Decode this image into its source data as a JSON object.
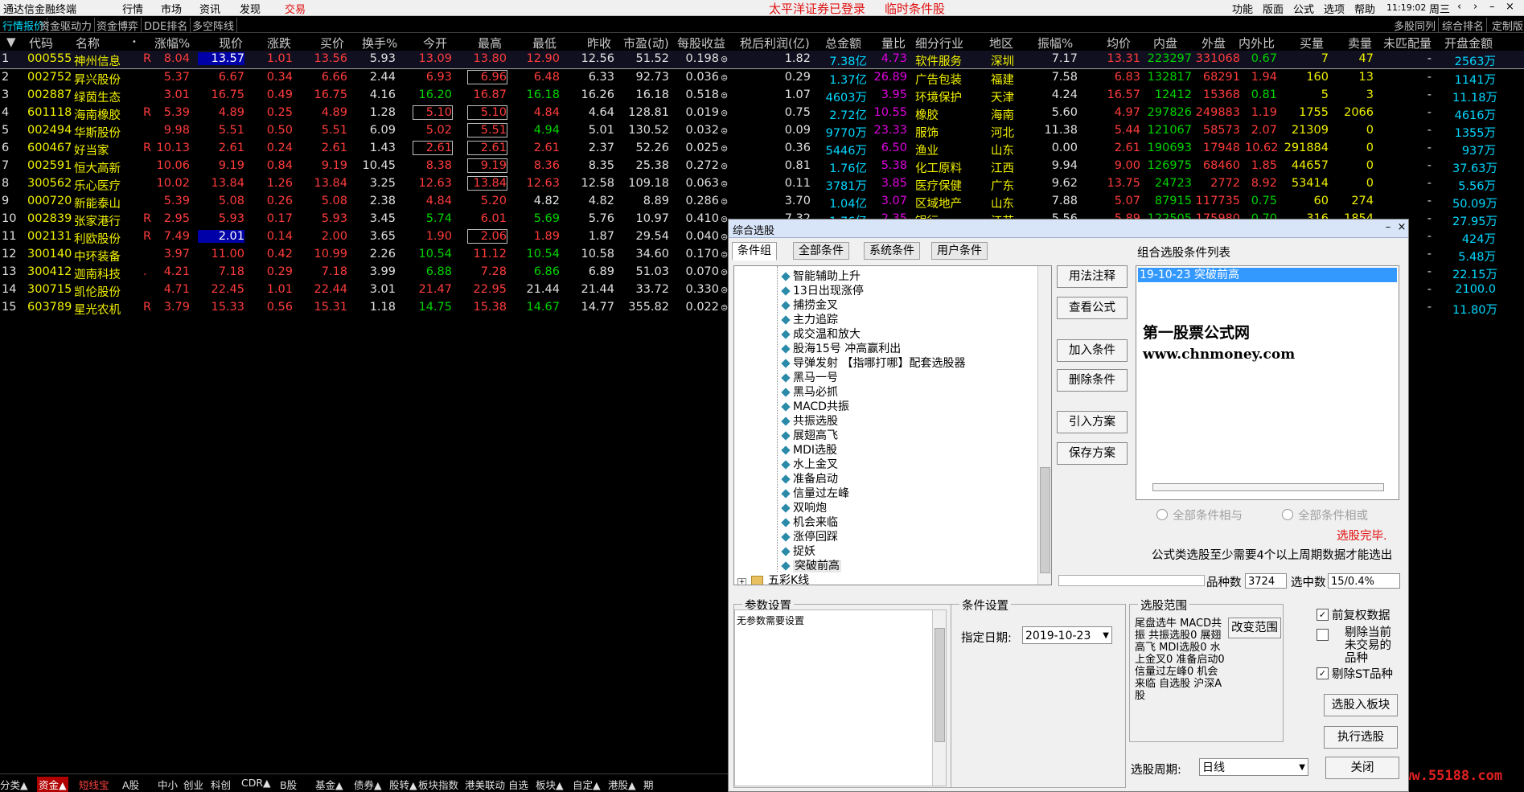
{
  "menu": {
    "app_title": "通达信金融终端",
    "items": [
      "行情",
      "市场",
      "资讯",
      "发现",
      "交易"
    ],
    "banner_login": "太平洋证券已登录",
    "banner_stock": "临时条件股",
    "right_items": [
      "功能",
      "版面",
      "公式",
      "选项",
      "帮助"
    ],
    "time": "11:19:02",
    "weekday": "周三"
  },
  "tabs": {
    "left": [
      "行情报价",
      "资金驱动力",
      "资金博弈",
      "DDE排名",
      "多空阵线"
    ],
    "right": [
      "多股同列",
      "综合排名",
      "定制版"
    ]
  },
  "table": {
    "headers": [
      "代码",
      "名称",
      "涨幅%",
      "现价",
      "涨跌",
      "买价",
      "换手%",
      "今开",
      "最高",
      "最低",
      "昨收",
      "市盈(动)",
      "每股收益",
      "税后利润(亿)",
      "总金额",
      "量比",
      "细分行业",
      "地区",
      "振幅%",
      "均价",
      "内盘",
      "外盘",
      "内外比",
      "买量",
      "卖量",
      "未匹配量",
      "开盘金额"
    ],
    "rows": [
      {
        "n": "1",
        "code": "000555",
        "name": "神州信息",
        "r": "R",
        "zf": "8.04",
        "xj": "13.57",
        "zd": "1.01",
        "mj": "13.56",
        "hs": "5.93",
        "jk": "13.09",
        "zg": "13.80",
        "zdi": "12.90",
        "zs": "12.56",
        "syl": "51.52",
        "mgsy": "0.198",
        "lr": "1.82",
        "zje": "7.38亿",
        "lb": "4.73",
        "hy": "软件服务",
        "dq": "深圳",
        "zf2": "7.17",
        "jj": "13.31",
        "np": "223297",
        "wp": "331068",
        "nwb": "0.67",
        "ml": "7",
        "sl": "47",
        "wpp": "-",
        "kpje": "2563万"
      },
      {
        "n": "2",
        "code": "002752",
        "name": "昇兴股份",
        "r": "",
        "zf": "5.37",
        "xj": "6.67",
        "zd": "0.34",
        "mj": "6.66",
        "hs": "2.44",
        "jk": "6.93",
        "zg": "6.96",
        "zdi": "6.48",
        "zs": "6.33",
        "syl": "92.73",
        "mgsy": "0.036",
        "lr": "0.29",
        "zje": "1.37亿",
        "lb": "26.89",
        "hy": "广告包装",
        "dq": "福建",
        "zf2": "7.58",
        "jj": "6.83",
        "np": "132817",
        "wp": "68291",
        "nwb": "1.94",
        "ml": "160",
        "sl": "13",
        "wpp": "-",
        "kpje": "1141万"
      },
      {
        "n": "3",
        "code": "002887",
        "name": "绿茵生态",
        "r": "",
        "zf": "3.01",
        "xj": "16.75",
        "zd": "0.49",
        "mj": "16.75",
        "hs": "4.16",
        "jk": "16.20",
        "zg": "16.87",
        "zdi": "16.18",
        "zs": "16.26",
        "syl": "16.18",
        "mgsy": "0.518",
        "lr": "1.07",
        "zje": "4603万",
        "lb": "3.95",
        "hy": "环境保护",
        "dq": "天津",
        "zf2": "4.24",
        "jj": "16.57",
        "np": "12412",
        "wp": "15368",
        "nwb": "0.81",
        "ml": "5",
        "sl": "3",
        "wpp": "-",
        "kpje": "11.18万"
      },
      {
        "n": "4",
        "code": "601118",
        "name": "海南橡胶",
        "r": "R",
        "zf": "5.39",
        "xj": "4.89",
        "zd": "0.25",
        "mj": "4.89",
        "hs": "1.28",
        "jk": "5.10",
        "zg": "5.10",
        "zdi": "4.84",
        "zs": "4.64",
        "syl": "128.81",
        "mgsy": "0.019",
        "lr": "0.75",
        "zje": "2.72亿",
        "lb": "10.55",
        "hy": "橡胶",
        "dq": "海南",
        "zf2": "5.60",
        "jj": "4.97",
        "np": "297826",
        "wp": "249883",
        "nwb": "1.19",
        "ml": "1755",
        "sl": "2066",
        "wpp": "-",
        "kpje": "4616万"
      },
      {
        "n": "5",
        "code": "002494",
        "name": "华斯股份",
        "r": "",
        "zf": "9.98",
        "xj": "5.51",
        "zd": "0.50",
        "mj": "5.51",
        "hs": "6.09",
        "jk": "5.02",
        "zg": "5.51",
        "zdi": "4.94",
        "zs": "5.01",
        "syl": "130.52",
        "mgsy": "0.032",
        "lr": "0.09",
        "zje": "9770万",
        "lb": "23.33",
        "hy": "服饰",
        "dq": "河北",
        "zf2": "11.38",
        "jj": "5.44",
        "np": "121067",
        "wp": "58573",
        "nwb": "2.07",
        "ml": "21309",
        "sl": "0",
        "wpp": "-",
        "kpje": "1355万"
      },
      {
        "n": "6",
        "code": "600467",
        "name": "好当家",
        "r": "R",
        "zf": "10.13",
        "xj": "2.61",
        "zd": "0.24",
        "mj": "2.61",
        "hs": "1.43",
        "jk": "2.61",
        "zg": "2.61",
        "zdi": "2.61",
        "zs": "2.37",
        "syl": "52.26",
        "mgsy": "0.025",
        "lr": "0.36",
        "zje": "5446万",
        "lb": "6.50",
        "hy": "渔业",
        "dq": "山东",
        "zf2": "0.00",
        "jj": "2.61",
        "np": "190693",
        "wp": "17948",
        "nwb": "10.62",
        "ml": "291884",
        "sl": "0",
        "wpp": "-",
        "kpje": "937万"
      },
      {
        "n": "7",
        "code": "002591",
        "name": "恒大高新",
        "r": "",
        "zf": "10.06",
        "xj": "9.19",
        "zd": "0.84",
        "mj": "9.19",
        "hs": "10.45",
        "jk": "8.38",
        "zg": "9.19",
        "zdi": "8.36",
        "zs": "8.35",
        "syl": "25.38",
        "mgsy": "0.272",
        "lr": "0.81",
        "zje": "1.76亿",
        "lb": "5.38",
        "hy": "化工原料",
        "dq": "江西",
        "zf2": "9.94",
        "jj": "9.00",
        "np": "126975",
        "wp": "68460",
        "nwb": "1.85",
        "ml": "44657",
        "sl": "0",
        "wpp": "-",
        "kpje": "37.63万"
      },
      {
        "n": "8",
        "code": "300562",
        "name": "乐心医疗",
        "r": "",
        "zf": "10.02",
        "xj": "13.84",
        "zd": "1.26",
        "mj": "13.84",
        "hs": "3.25",
        "jk": "12.63",
        "zg": "13.84",
        "zdi": "12.63",
        "zs": "12.58",
        "syl": "109.18",
        "mgsy": "0.063",
        "lr": "0.11",
        "zje": "3781万",
        "lb": "3.85",
        "hy": "医疗保健",
        "dq": "广东",
        "zf2": "9.62",
        "jj": "13.75",
        "np": "24723",
        "wp": "2772",
        "nwb": "8.92",
        "ml": "53414",
        "sl": "0",
        "wpp": "-",
        "kpje": "5.56万"
      },
      {
        "n": "9",
        "code": "000720",
        "name": "新能泰山",
        "r": "",
        "zf": "5.39",
        "xj": "5.08",
        "zd": "0.26",
        "mj": "5.08",
        "hs": "2.38",
        "jk": "4.84",
        "zg": "5.20",
        "zdi": "4.82",
        "zs": "4.82",
        "syl": "8.89",
        "mgsy": "0.286",
        "lr": "3.70",
        "zje": "1.04亿",
        "lb": "3.07",
        "hy": "区域地产",
        "dq": "山东",
        "zf2": "7.88",
        "jj": "5.07",
        "np": "87915",
        "wp": "117735",
        "nwb": "0.75",
        "ml": "60",
        "sl": "274",
        "wpp": "-",
        "kpje": "50.09万"
      },
      {
        "n": "10",
        "code": "002839",
        "name": "张家港行",
        "r": "R",
        "zf": "2.95",
        "xj": "5.93",
        "zd": "0.17",
        "mj": "5.93",
        "hs": "3.45",
        "jk": "5.74",
        "zg": "6.01",
        "zdi": "5.69",
        "zs": "5.76",
        "syl": "10.97",
        "mgsy": "0.410",
        "lr": "7.32",
        "zje": "1.76亿",
        "lb": "2.35",
        "hy": "银行",
        "dq": "江苏",
        "zf2": "5.56",
        "jj": "5.89",
        "np": "122505",
        "wp": "175980",
        "nwb": "0.70",
        "ml": "316",
        "sl": "1854",
        "wpp": "-",
        "kpje": "27.95万"
      },
      {
        "n": "11",
        "code": "002131",
        "name": "利欧股份",
        "r": "R",
        "zf": "7.49",
        "xj": "2.01",
        "zd": "0.14",
        "mj": "2.00",
        "hs": "3.65",
        "jk": "1.90",
        "zg": "2.06",
        "zdi": "1.89",
        "zs": "1.87",
        "syl": "29.54",
        "mgsy": "0.040",
        "lr": "",
        "zje": "",
        "lb": "",
        "hy": "",
        "dq": "",
        "zf2": "",
        "jj": "",
        "np": "",
        "wp": "",
        "nwb": "",
        "ml": "",
        "sl": "",
        "wpp": "-",
        "kpje": "424万"
      },
      {
        "n": "12",
        "code": "300140",
        "name": "中环装备",
        "r": "",
        "zf": "3.97",
        "xj": "11.00",
        "zd": "0.42",
        "mj": "10.99",
        "hs": "2.26",
        "jk": "10.54",
        "zg": "11.12",
        "zdi": "10.54",
        "zs": "10.58",
        "syl": "34.60",
        "mgsy": "0.170",
        "lr": "",
        "zje": "",
        "lb": "",
        "hy": "",
        "dq": "",
        "zf2": "",
        "jj": "",
        "np": "",
        "wp": "",
        "nwb": "",
        "ml": "",
        "sl": "",
        "wpp": "-",
        "kpje": "5.48万"
      },
      {
        "n": "13",
        "code": "300412",
        "name": "迦南科技",
        "r": ".",
        "zf": "4.21",
        "xj": "7.18",
        "zd": "0.29",
        "mj": "7.18",
        "hs": "3.99",
        "jk": "6.88",
        "zg": "7.28",
        "zdi": "6.86",
        "zs": "6.89",
        "syl": "51.03",
        "mgsy": "0.070",
        "lr": "",
        "zje": "",
        "lb": "",
        "hy": "",
        "dq": "",
        "zf2": "",
        "jj": "",
        "np": "",
        "wp": "",
        "nwb": "",
        "ml": "",
        "sl": "",
        "wpp": "-",
        "kpje": "22.15万"
      },
      {
        "n": "14",
        "code": "300715",
        "name": "凯伦股份",
        "r": "",
        "zf": "4.71",
        "xj": "22.45",
        "zd": "1.01",
        "mj": "22.44",
        "hs": "3.01",
        "jk": "21.47",
        "zg": "22.95",
        "zdi": "21.44",
        "zs": "21.44",
        "syl": "33.72",
        "mgsy": "0.330",
        "lr": "",
        "zje": "",
        "lb": "",
        "hy": "",
        "dq": "",
        "zf2": "",
        "jj": "",
        "np": "",
        "wp": "",
        "nwb": "",
        "ml": "",
        "sl": "",
        "wpp": "-",
        "kpje": "2100.0"
      },
      {
        "n": "15",
        "code": "603789",
        "name": "星光农机",
        "r": "R",
        "zf": "3.79",
        "xj": "15.33",
        "zd": "0.56",
        "mj": "15.31",
        "hs": "1.18",
        "jk": "14.75",
        "zg": "15.38",
        "zdi": "14.67",
        "zs": "14.77",
        "syl": "355.82",
        "mgsy": "0.022",
        "lr": "",
        "zje": "",
        "lb": "",
        "hy": "",
        "dq": "",
        "zf2": "",
        "jj": "",
        "np": "",
        "wp": "",
        "nwb": "",
        "ml": "",
        "sl": "",
        "wpp": "-",
        "kpje": "11.80万"
      }
    ]
  },
  "bottom_tabs": [
    "分类▲",
    "资金▲",
    "短线宝",
    "A股",
    "中小",
    "创业",
    "科创",
    "CDR▲",
    "B股",
    "基金▲",
    "债券▲",
    "股转▲",
    "板块指数",
    "港美联动",
    "自选",
    "板块▲",
    "自定▲",
    "港股▲",
    "期"
  ],
  "watermark_site": "www.55188.com",
  "dialog": {
    "title": "综合选股",
    "tabs": [
      "条件组",
      "全部条件",
      "系统条件",
      "用户条件"
    ],
    "tree_items": [
      "智能辅助上升",
      "13日出现涨停",
      "捕捞金叉",
      "主力追踪",
      "成交温和放大",
      "股海15号 冲高赢利出",
      "导弹发射 【指哪打哪】配套选股器",
      "黑马一号",
      "黑马必抓",
      "MACD共振",
      "共振选股",
      "展翅高飞",
      "MDI选股",
      "水上金叉",
      "准备启动",
      "信量过左峰",
      "双响炮",
      "机会来临",
      "涨停回踩",
      "捉妖",
      "突破前高"
    ],
    "tree_folder": "五彩K线",
    "buttons": {
      "usage": "用法注释",
      "view_formula": "查看公式",
      "add": "加入条件",
      "delete": "删除条件",
      "import": "引入方案",
      "save": "保存方案",
      "change_range": "改变范围",
      "to_block": "选股入板块",
      "execute": "执行选股",
      "close": "关闭"
    },
    "list_title": "组合选股条件列表",
    "list_selected": "19-10-23 突破前高",
    "wm_name": "第一股票公式网",
    "wm_url": "www.chnmoney.com",
    "radio_and": "全部条件相与",
    "radio_or": "全部条件相或",
    "status": "选股完毕.",
    "note": "公式类选股至少需要4个以上周期数据才能选出",
    "count_label": "品种数",
    "count_value": "3724",
    "picked_label": "选中数",
    "picked_value": "15/0.4%",
    "param_title": "参数设置",
    "param_text": "无参数需要设置",
    "cond_title": "条件设置",
    "date_label": "指定日期:",
    "date_value": "2019-10-23",
    "range_title": "选股范围",
    "range_text": "尾盘选牛 MACD共振 共振选股0 展翅高飞 MDI选股0 水上金叉0 准备启动0 信量过左峰0 机会来临 自选股 沪深A股",
    "chk_rights": "前复权数据",
    "chk_unlisted": "剔除当前未交易的品种",
    "chk_st": "剔除ST品种",
    "period_label": "选股周期:",
    "period_value": "日线"
  }
}
